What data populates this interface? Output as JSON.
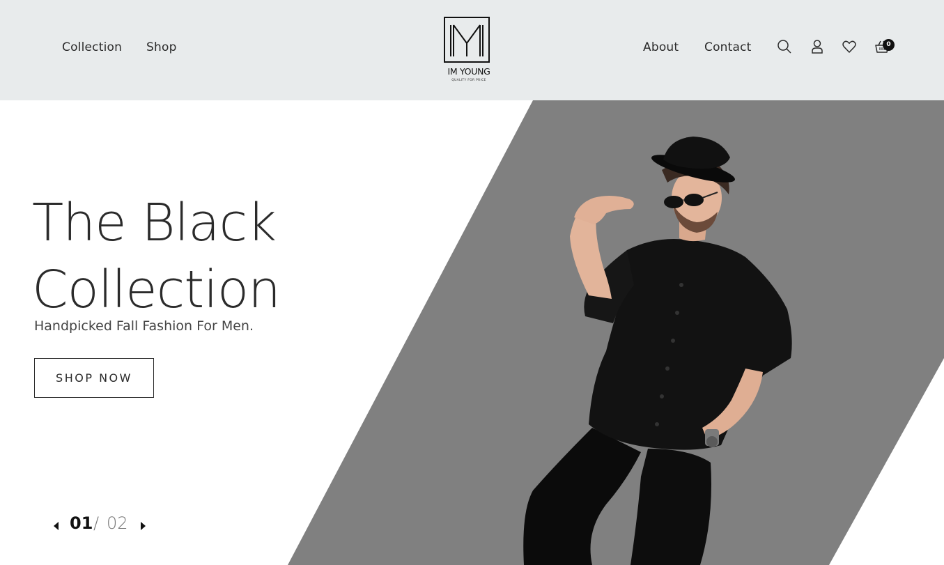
{
  "header": {
    "nav_left": [
      "Collection",
      "Shop"
    ],
    "nav_right": [
      "About",
      "Contact"
    ],
    "logo": {
      "monogram": "M",
      "name": "IM YOUNG",
      "tagline": "QUALITY FOR PRICE"
    },
    "icons": [
      "search-icon",
      "user-icon",
      "heart-icon",
      "basket-icon"
    ],
    "cart_count": "0"
  },
  "hero": {
    "title_line1": "The Black",
    "title_line2": "Collection",
    "subtitle": "Handpicked Fall Fashion For Men.",
    "cta_label": "SHOP NOW",
    "pager": {
      "current": "01",
      "separator": "/",
      "total": "02"
    }
  },
  "colors": {
    "header_bg": "#e8ebec",
    "hero_panel": "#808080",
    "text_dark": "#2b2b2b"
  }
}
